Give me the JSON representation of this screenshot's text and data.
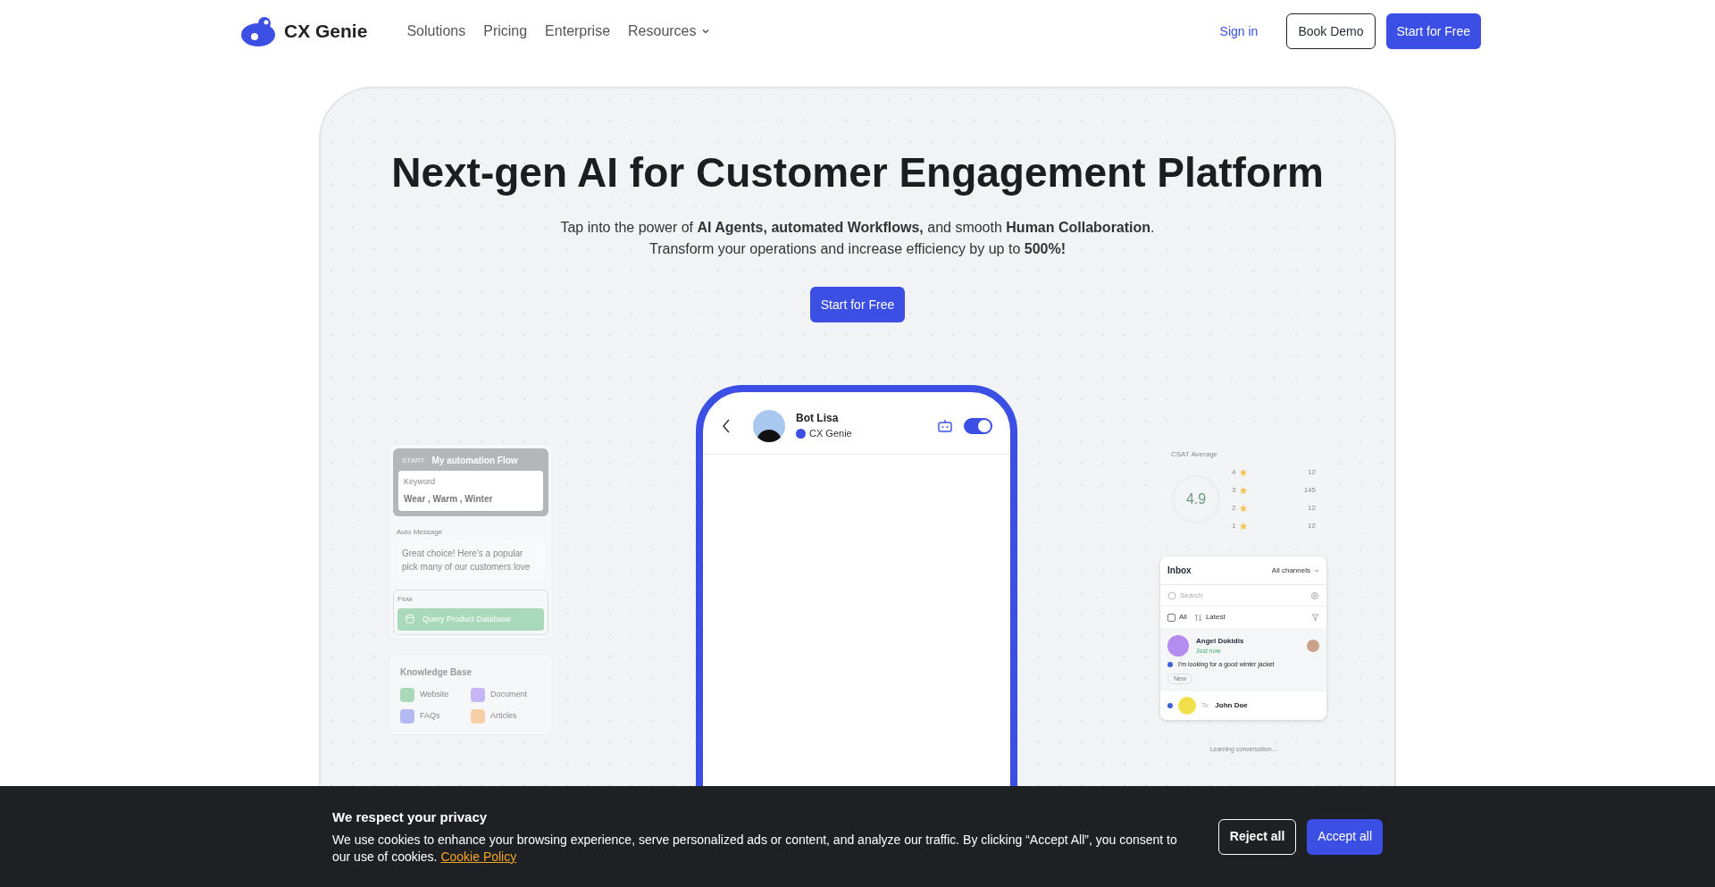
{
  "nav": {
    "logo_text": "CX Genie",
    "links": [
      {
        "label": "Solutions",
        "dropdown": false
      },
      {
        "label": "Pricing",
        "dropdown": false
      },
      {
        "label": "Enterprise",
        "dropdown": false
      },
      {
        "label": "Resources",
        "dropdown": true
      }
    ],
    "sign_in": "Sign in",
    "book_demo": "Book Demo",
    "start_free": "Start for Free"
  },
  "hero": {
    "title": "Next-gen AI for Customer Engagement Platform",
    "subtitle_lines": [
      "Tap into the power of **AI Agents, automated Workflows,** and smooth **Human Collaboration**.",
      "Transform your operations and increase efficiency by up to **500%!**"
    ],
    "cta": "Start for Free"
  },
  "flow": {
    "start_tag": "START",
    "title": "My automation Flow",
    "keyword_label": "Keyword",
    "keywords": "Wear , Warm , Winter",
    "auto_message_label": "Auto Message",
    "auto_message": "Great choice! Here's a popular pick many of our customers love",
    "flow_label": "Flow",
    "flow_action": "Query Product Database"
  },
  "knowledge": {
    "title": "Knowledge Base",
    "items": [
      {
        "label": "Website",
        "color": "#a9d9b9"
      },
      {
        "label": "Document",
        "color": "#c7b6f5"
      },
      {
        "label": "FAQs",
        "color": "#b3bbf2"
      },
      {
        "label": "Articles",
        "color": "#f7cfa6"
      }
    ]
  },
  "phone": {
    "bot_name": "Bot Lisa",
    "brand": "CX Genie",
    "bot_on": true
  },
  "csat": {
    "title": "CSAT Average",
    "score": "4.9",
    "rows": [
      {
        "rating": "4",
        "count": "12"
      },
      {
        "rating": "3",
        "count": "145"
      },
      {
        "rating": "2",
        "count": "12"
      },
      {
        "rating": "1",
        "count": "12"
      }
    ]
  },
  "inbox": {
    "title": "Inbox",
    "channel_filter": "All channels",
    "search_placeholder": "Search",
    "filter": "All",
    "sort": "Latest",
    "conversations": [
      {
        "kind": "full",
        "name": "Angel Dokidis",
        "time": "Just now",
        "message": "I'm looking for a good winter jacket",
        "tag": "New",
        "unread": true
      },
      {
        "kind": "outgoing",
        "to_label": "To:",
        "name": "John Doe",
        "unread": true
      }
    ]
  },
  "learning": "Learning conversation...",
  "cookie": {
    "title": "We respect your privacy",
    "text": "We use cookies to enhance your browsing experience, serve personalized ads or content, and analyze our traffic. By clicking “Accept All”, you consent to our use of cookies.",
    "link": "Cookie Policy",
    "reject": "Reject all",
    "accept": "Accept all"
  }
}
